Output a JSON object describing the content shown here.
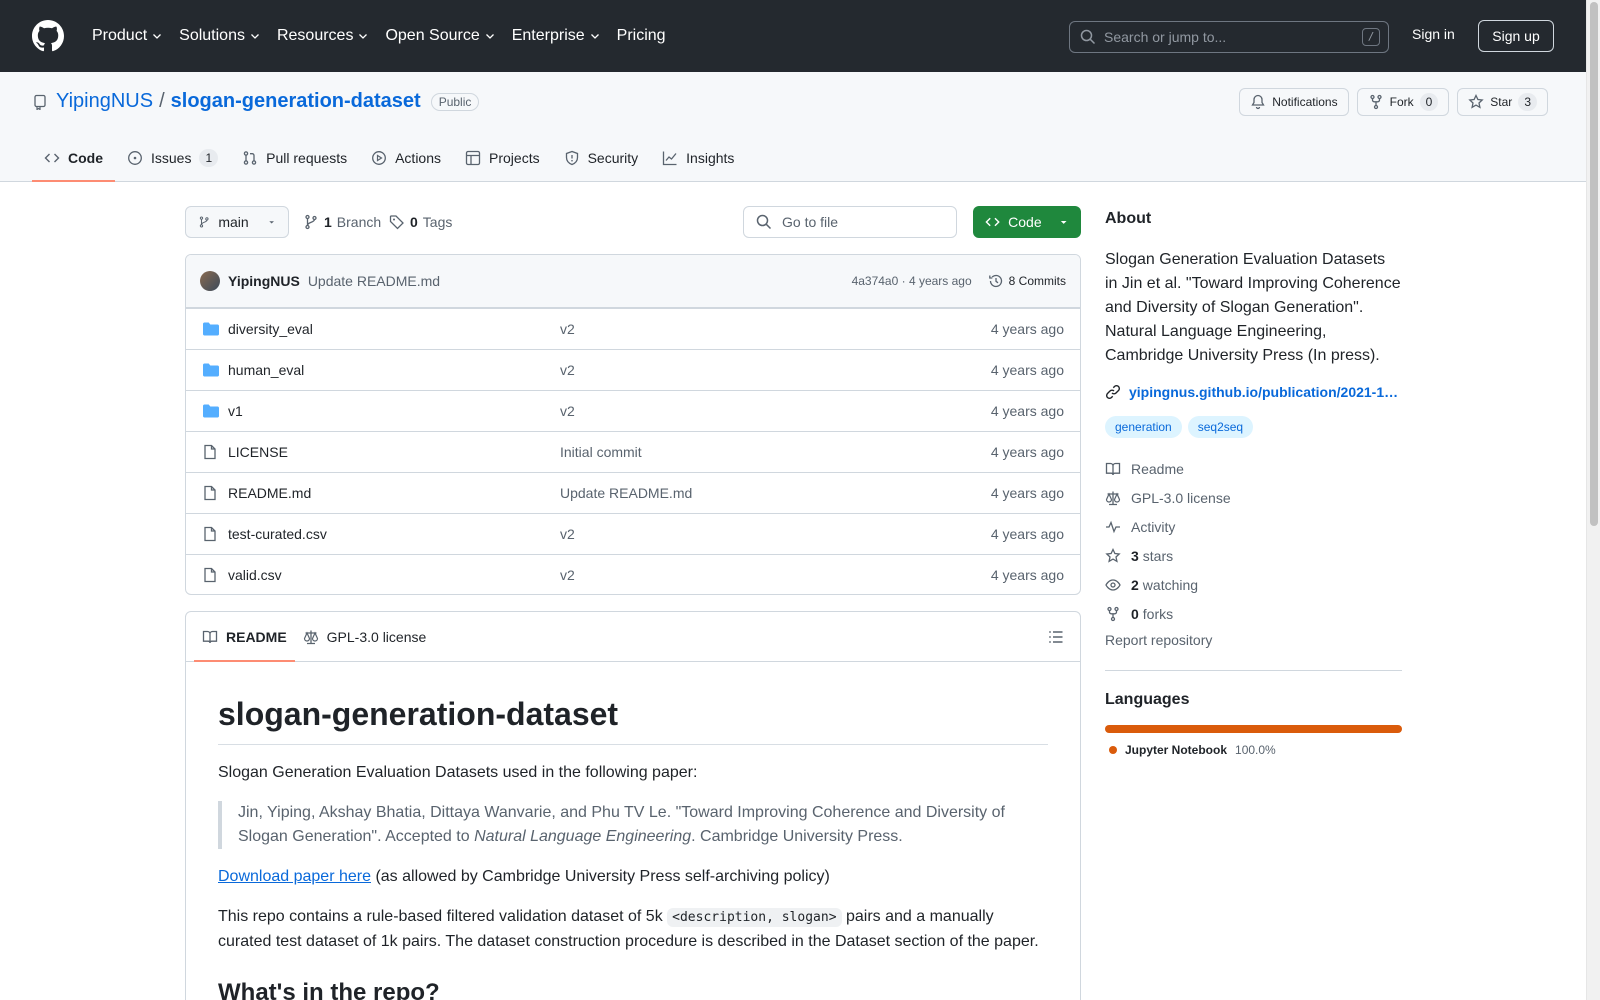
{
  "topnav": {
    "items": [
      "Product",
      "Solutions",
      "Resources",
      "Open Source",
      "Enterprise",
      "Pricing"
    ],
    "search_placeholder": "Search or jump to...",
    "search_shortcut": "/",
    "signin": "Sign in",
    "signup": "Sign up"
  },
  "repo": {
    "owner": "YipingNUS",
    "separator": "/",
    "name": "slogan-generation-dataset",
    "visibility": "Public",
    "notifications_label": "Notifications",
    "fork_label": "Fork",
    "fork_count": "0",
    "star_label": "Star",
    "star_count": "3"
  },
  "tabs": [
    {
      "label": "Code",
      "icon": "code-icon",
      "count": ""
    },
    {
      "label": "Issues",
      "icon": "issue-icon",
      "count": "1"
    },
    {
      "label": "Pull requests",
      "icon": "pull-request-icon",
      "count": ""
    },
    {
      "label": "Actions",
      "icon": "play-icon",
      "count": ""
    },
    {
      "label": "Projects",
      "icon": "table-icon",
      "count": ""
    },
    {
      "label": "Security",
      "icon": "shield-icon",
      "count": ""
    },
    {
      "label": "Insights",
      "icon": "graph-icon",
      "count": ""
    }
  ],
  "toolbar": {
    "branch": "main",
    "branch_count": "1",
    "branch_label": "Branch",
    "tag_count": "0",
    "tag_label": "Tags",
    "goto_placeholder": "Go to file",
    "code_button": "Code"
  },
  "commit": {
    "author": "YipingNUS",
    "message": "Update README.md",
    "hash_time": "4a374a0 · 4 years ago",
    "commits_label": "8 Commits"
  },
  "files": [
    {
      "type": "folder",
      "name": "diversity_eval",
      "commit": "v2",
      "date": "4 years ago"
    },
    {
      "type": "folder",
      "name": "human_eval",
      "commit": "v2",
      "date": "4 years ago"
    },
    {
      "type": "folder",
      "name": "v1",
      "commit": "v2",
      "date": "4 years ago"
    },
    {
      "type": "file",
      "name": "LICENSE",
      "commit": "Initial commit",
      "date": "4 years ago"
    },
    {
      "type": "file",
      "name": "README.md",
      "commit": "Update README.md",
      "date": "4 years ago"
    },
    {
      "type": "file",
      "name": "test-curated.csv",
      "commit": "v2",
      "date": "4 years ago"
    },
    {
      "type": "file",
      "name": "valid.csv",
      "commit": "v2",
      "date": "4 years ago"
    }
  ],
  "readme": {
    "tab_readme": "README",
    "tab_license": "GPL-3.0 license",
    "title": "slogan-generation-dataset",
    "intro": "Slogan Generation Evaluation Datasets used in the following paper:",
    "quote_part1": "Jin, Yiping, Akshay Bhatia, Dittaya Wanvarie, and Phu TV Le. \"Toward Improving Coherence and Diversity of Slogan Generation\". Accepted to ",
    "quote_journal": "Natural Language Engineering",
    "quote_part2": ". Cambridge University Press.",
    "download_link": "Download paper here",
    "download_rest": " (as allowed by Cambridge University Press self-archiving policy)",
    "desc_part1": "This repo contains a rule-based filtered validation dataset of 5k ",
    "desc_code": "<description, slogan>",
    "desc_part2": " pairs and a manually curated test dataset of 1k pairs. The dataset construction procedure is described in the Dataset section of the paper.",
    "h2": "What's in the repo?"
  },
  "about": {
    "heading": "About",
    "description": "Slogan Generation Evaluation Datasets in Jin et al. \"Toward Improving Coherence and Diversity of Slogan Generation\". Natural Language Engineering, Cambridge University Press (In press).",
    "url": "yipingnus.github.io/publication/2021-1…",
    "topics": [
      "generation",
      "seq2seq"
    ],
    "readme": "Readme",
    "license": "GPL-3.0 license",
    "activity": "Activity",
    "stars_count": "3",
    "stars_label": "stars",
    "watching_count": "2",
    "watching_label": "watching",
    "forks_count": "0",
    "forks_label": "forks",
    "report": "Report repository"
  },
  "languages": {
    "heading": "Languages",
    "items": [
      {
        "name": "Jupyter Notebook",
        "percent": "100.0%",
        "share": 1.0,
        "color": "#DA5B0B"
      }
    ]
  },
  "colors": {
    "header_bg": "#24292f",
    "link": "#0969da",
    "primary_button": "#1f883d",
    "active_tab_underline": "#fd8c73",
    "folder_icon": "#54aeff"
  }
}
